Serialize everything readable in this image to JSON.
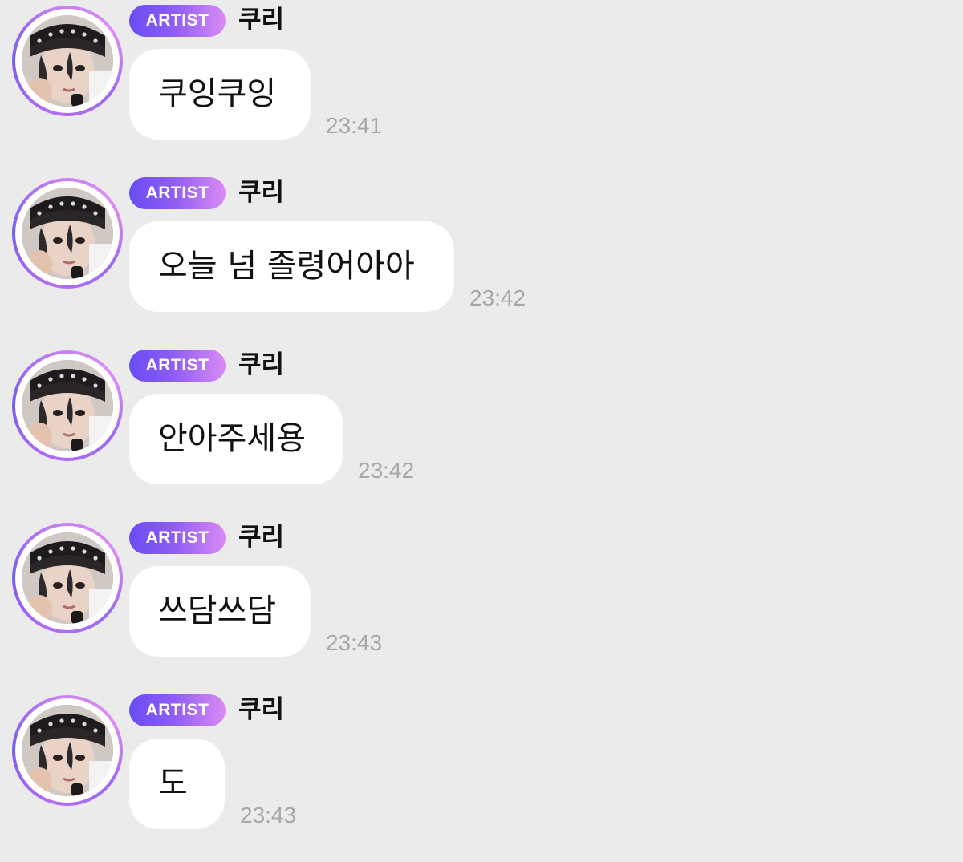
{
  "chat": {
    "messages": [
      {
        "badge": "ARTIST",
        "sender": "쿠리",
        "text": "쿠잉쿠잉",
        "time": "23:41",
        "avatar_icon": "artist-avatar"
      },
      {
        "badge": "ARTIST",
        "sender": "쿠리",
        "text": "오늘 넘 졸령어아아",
        "time": "23:42",
        "avatar_icon": "artist-avatar"
      },
      {
        "badge": "ARTIST",
        "sender": "쿠리",
        "text": "안아주세용",
        "time": "23:42",
        "avatar_icon": "artist-avatar"
      },
      {
        "badge": "ARTIST",
        "sender": "쿠리",
        "text": "쓰담쓰담",
        "time": "23:43",
        "avatar_icon": "artist-avatar"
      },
      {
        "badge": "ARTIST",
        "sender": "쿠리",
        "text": "도",
        "time": "23:43",
        "avatar_icon": "artist-avatar"
      }
    ]
  },
  "colors": {
    "background": "#ebebeb",
    "bubble": "#ffffff",
    "badge_start": "#6a4cf3",
    "badge_end": "#d98af5",
    "timestamp": "#a7a7a7",
    "avatar_ring": "#9b6cf0"
  }
}
